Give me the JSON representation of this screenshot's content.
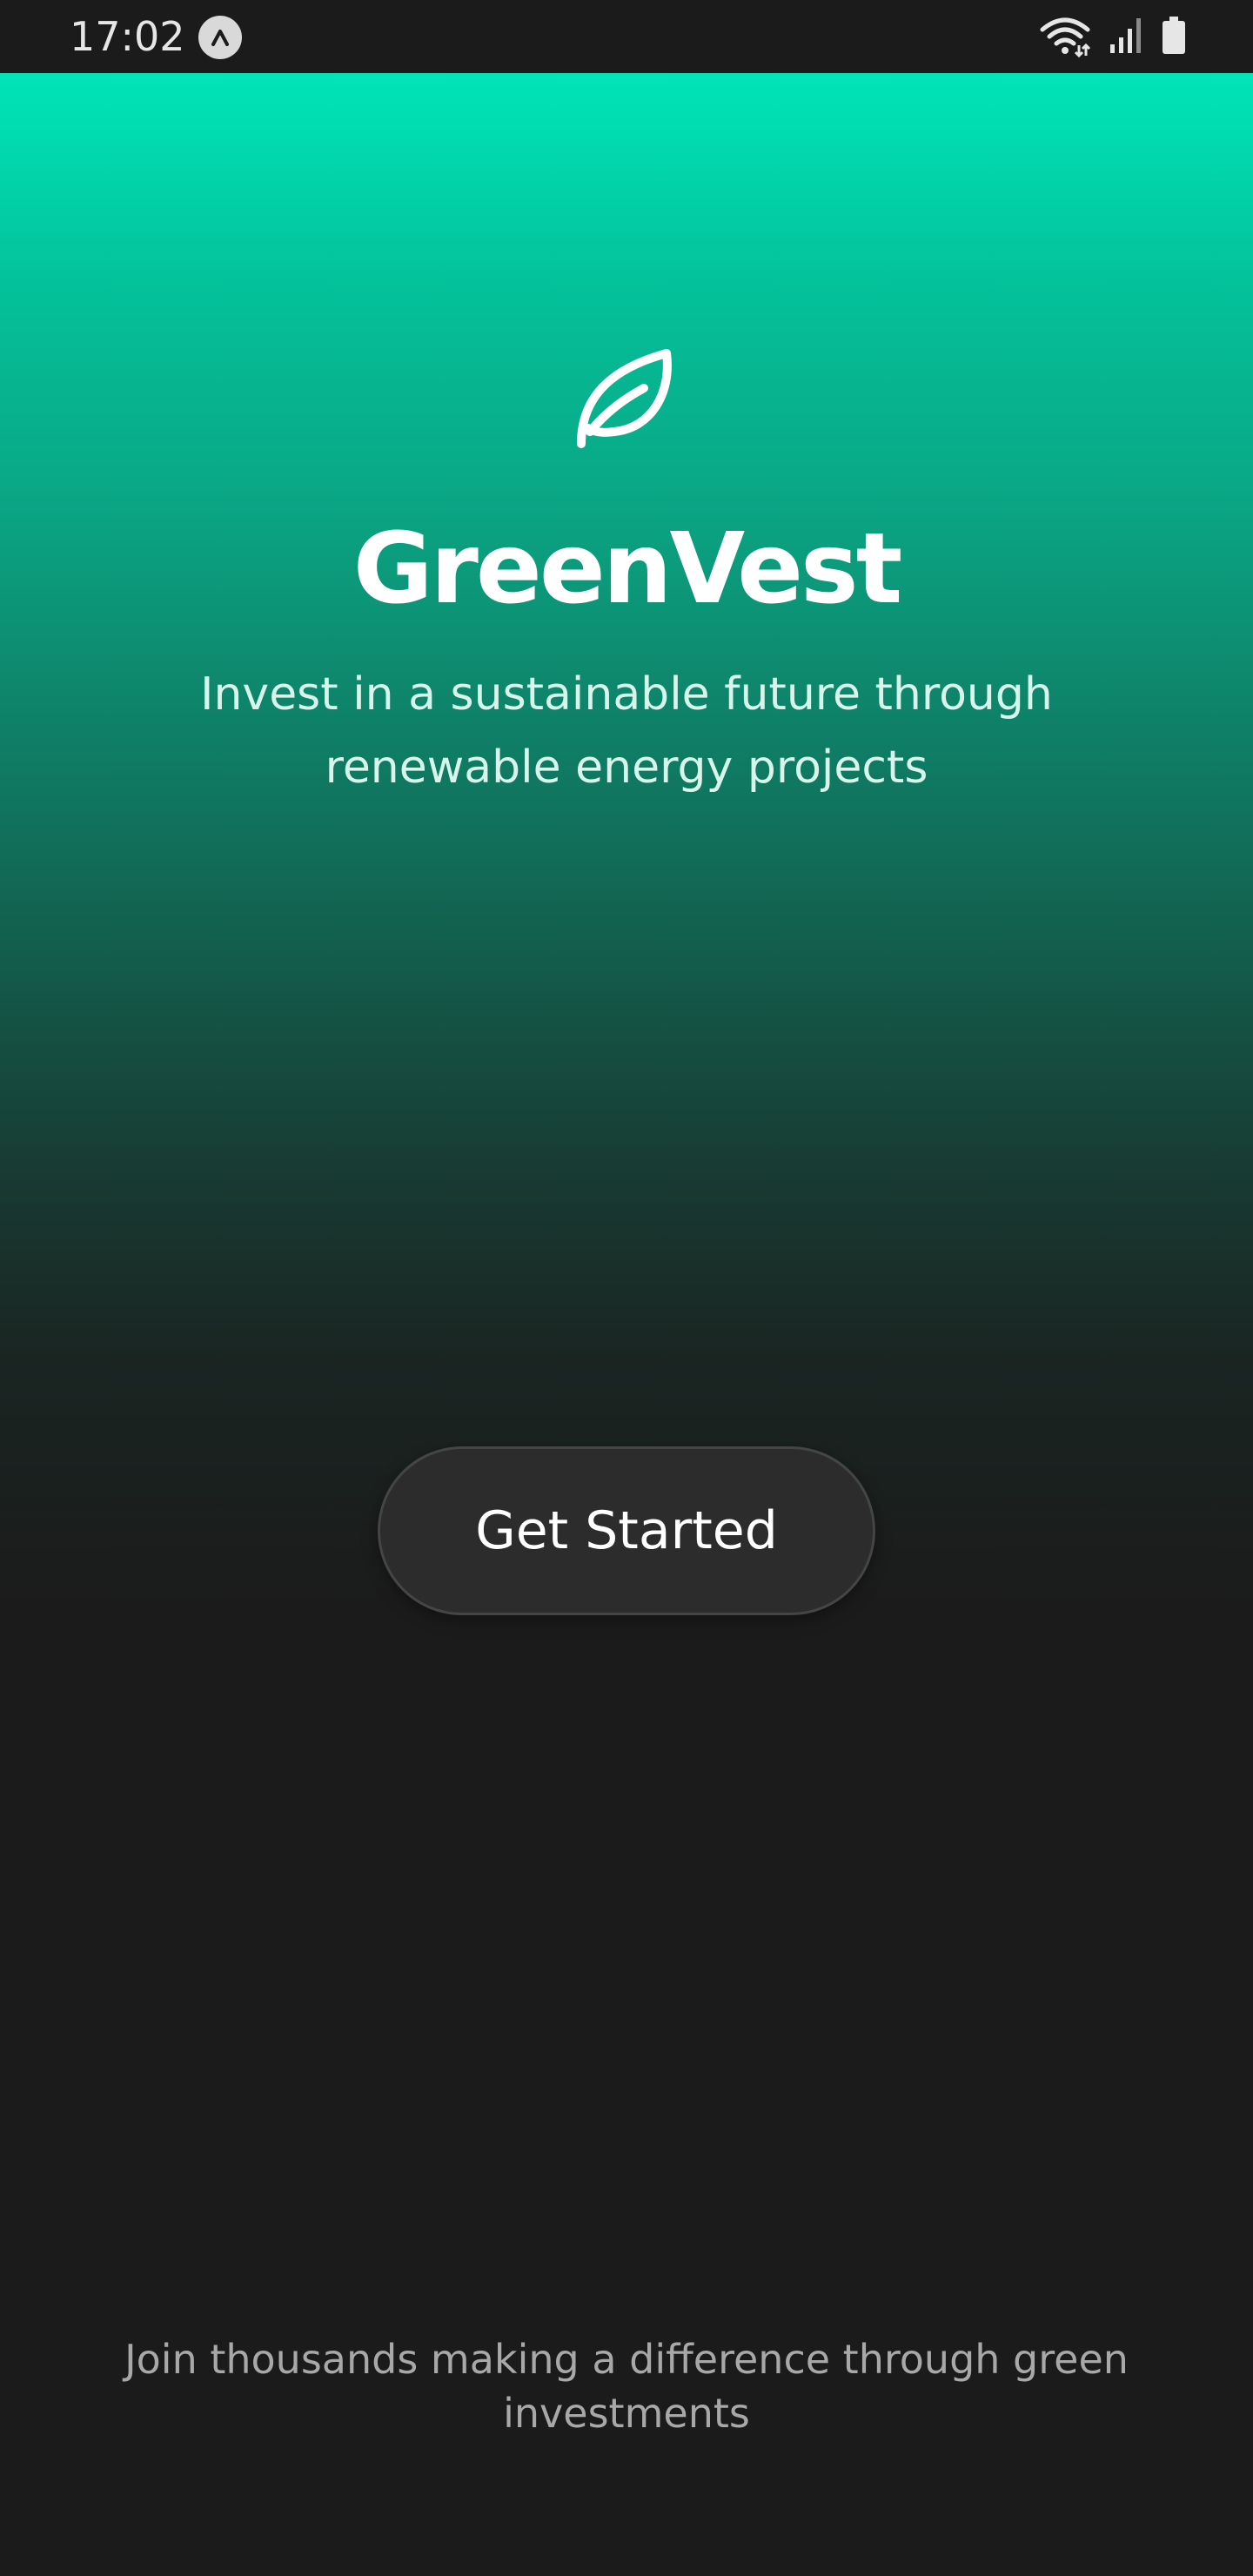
{
  "status_bar": {
    "time": "17:02",
    "app_icon": "arrow-up-notification-icon",
    "icons": [
      "wifi-icon",
      "signal-icon",
      "battery-icon"
    ]
  },
  "hero": {
    "logo_icon": "leaf-icon",
    "title": "GreenVest",
    "subtitle": "Invest in a sustainable future through renewable energy projects",
    "gradient_top_color": "#00e5b8",
    "gradient_bottom_color": "#1b1b1b"
  },
  "cta": {
    "label": "Get Started"
  },
  "footer": {
    "text": "Join thousands making a difference through green investments"
  },
  "colors": {
    "background": "#1b1b1b",
    "accent": "#00e5b8",
    "button_bg": "#2c2c2c"
  }
}
